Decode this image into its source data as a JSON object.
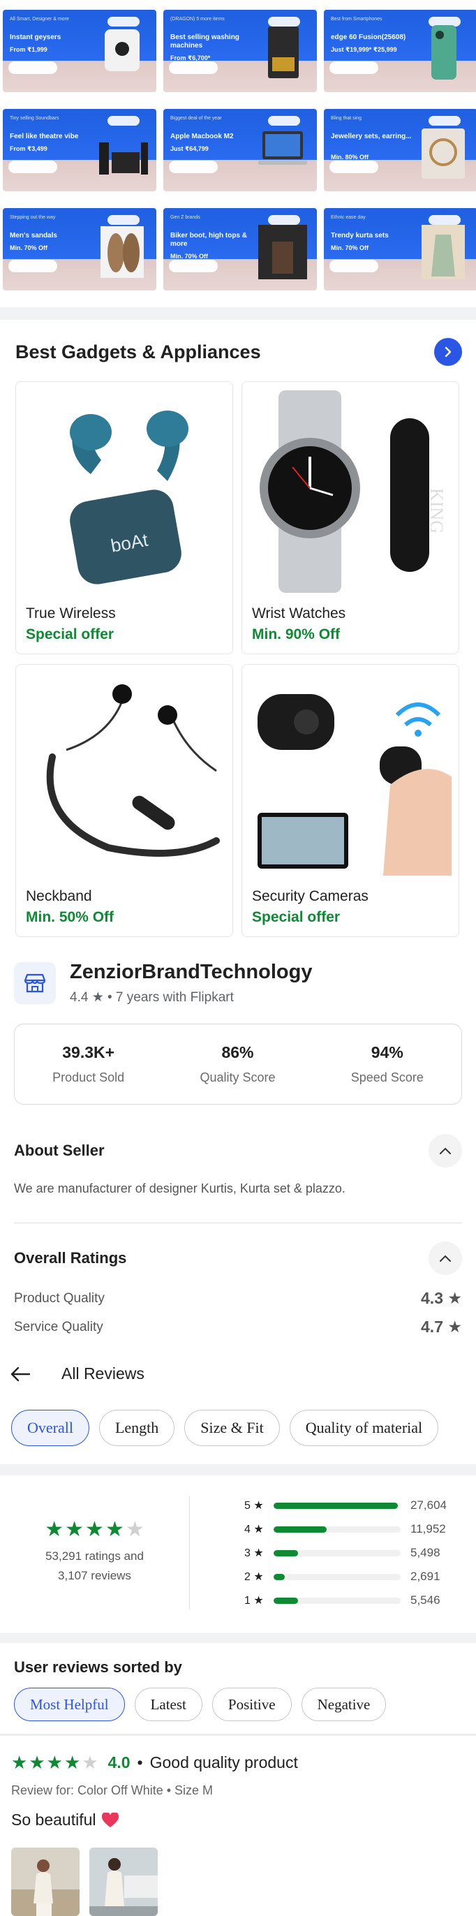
{
  "banners": [
    {
      "tag": "All Smart, Designer & more",
      "title": "Instant geysers",
      "price": "From ₹1,999",
      "kind": "geyser"
    },
    {
      "tag": "(DRAGON) 5 more items",
      "title": "Best selling washing machines",
      "price": "From ₹6,700*",
      "kind": "washer"
    },
    {
      "tag": "Best from Smartphones",
      "title": "edge 60 Fusion(25608)",
      "price": "Just ₹19,999* ₹25,999",
      "kind": "phone"
    },
    {
      "tag": "Tiny selling Soundbars",
      "title": "Feel like theatre vibe",
      "price": "From ₹3,499",
      "kind": "speakers"
    },
    {
      "tag": "Biggest deal of the year",
      "title": "Apple Macbook M2",
      "price": "Just ₹64,799",
      "kind": "laptop"
    },
    {
      "tag": "Bling that sing",
      "title": "Jewellery sets, earring...",
      "price": "Min. 80% Off",
      "kind": "jewel"
    },
    {
      "tag": "Stepping out the way",
      "title": "Men's sandals",
      "price": "Min. 70% Off",
      "kind": "sandal"
    },
    {
      "tag": "Gen Z brands",
      "title": "Biker boot, high tops & more",
      "price": "Min. 70% Off",
      "kind": "boots"
    },
    {
      "tag": "Ethnic ease day",
      "title": "Trendy kurta sets",
      "price": "Min. 70% Off",
      "kind": "kurta"
    }
  ],
  "gadgets": {
    "title": "Best Gadgets & Appliances",
    "items": [
      {
        "name": "True Wireless",
        "offer": "Special offer",
        "kind": "earbuds"
      },
      {
        "name": "Wrist Watches",
        "offer": "Min. 90% Off",
        "kind": "watch"
      },
      {
        "name": "Neckband",
        "offer": "Min. 50% Off",
        "kind": "neckband"
      },
      {
        "name": "Security Cameras",
        "offer": "Special offer",
        "kind": "camera"
      }
    ]
  },
  "seller": {
    "name": "ZenziorBrandTechnology",
    "meta": "4.4 ★ • 7 years with Flipkart",
    "stats": [
      {
        "value": "39.3K+",
        "label": "Product Sold"
      },
      {
        "value": "86%",
        "label": "Quality Score"
      },
      {
        "value": "94%",
        "label": "Speed Score"
      }
    ],
    "about_title": "About Seller",
    "about_text": "We are manufacturer of designer Kurtis, Kurta set & plazzo.",
    "ratings_title": "Overall Ratings",
    "ratings": [
      {
        "label": "Product Quality",
        "value": "4.3 ★"
      },
      {
        "label": "Service Quality",
        "value": "4.7 ★"
      }
    ]
  },
  "reviews": {
    "header": "All Reviews",
    "filters": [
      "Overall",
      "Length",
      "Size & Fit",
      "Quality of material"
    ],
    "active_filter": 0,
    "summary_line1": "53,291 ratings and",
    "summary_line2": "3,107 reviews",
    "avg_stars": 4,
    "breakdown": [
      {
        "label": "5 ★",
        "count": "27,604",
        "fraction": 0.98
      },
      {
        "label": "4 ★",
        "count": "11,952",
        "fraction": 0.42
      },
      {
        "label": "3 ★",
        "count": "5,498",
        "fraction": 0.19
      },
      {
        "label": "2 ★",
        "count": "2,691",
        "fraction": 0.09
      },
      {
        "label": "1 ★",
        "count": "5,546",
        "fraction": 0.19
      }
    ],
    "sorted_title": "User reviews sorted by",
    "sort_options": [
      "Most Helpful",
      "Latest",
      "Positive",
      "Negative"
    ],
    "active_sort": 0,
    "first_review": {
      "stars": 4,
      "score": "4.0",
      "dot": "•",
      "title": "Good quality product",
      "review_for": "Review for: Color Off White • Size M",
      "text": "So beautiful"
    }
  },
  "colors": {
    "accent": "#2a55e5",
    "green": "#108934"
  }
}
